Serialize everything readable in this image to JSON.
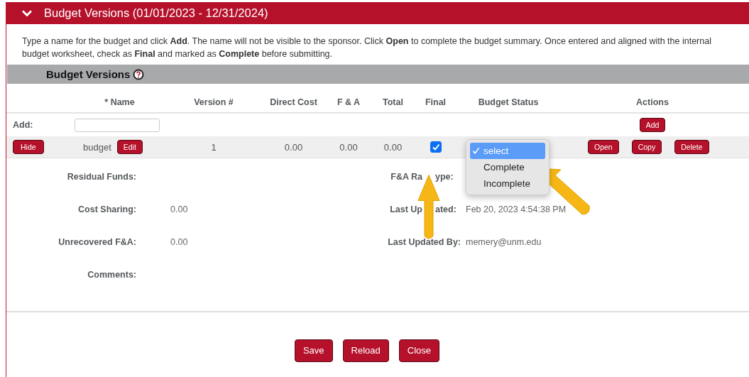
{
  "panel": {
    "title": "Budget Versions (01/01/2023 - 12/31/2024)",
    "expanded": true
  },
  "instructions": "Type a name for the budget and click **Add**. The name will not be visible to the sponsor. Click **Open** to complete the budget summary. Once entered and aligned with the internal budget worksheet, check as **Final** and marked as **Complete** before submitting.",
  "section": {
    "title": "Budget Versions"
  },
  "table": {
    "columns": [
      "* Name",
      "Version #",
      "Direct Cost",
      "F & A",
      "Total",
      "Final",
      "Budget Status",
      "Actions"
    ],
    "add_row": {
      "label": "Add:",
      "button": "Add"
    },
    "rows": [
      {
        "toggle_button": "Hide",
        "name": "budget",
        "edit_button": "Edit",
        "version": "1",
        "direct_cost": "0.00",
        "f_and_a": "0.00",
        "total": "0.00",
        "final": true,
        "actions": [
          "Open",
          "Copy",
          "Delete"
        ],
        "status_dropdown": {
          "options": [
            {
              "label": "select",
              "selected": true
            },
            {
              "label": "Complete",
              "selected": false
            },
            {
              "label": "Incomplete",
              "selected": false
            }
          ]
        }
      }
    ]
  },
  "details": [
    {
      "label": "Residual Funds:",
      "right_label": [
        "F&A Ra",
        "ype:"
      ]
    },
    {
      "label": "Cost Sharing:",
      "value": "0.00",
      "right_label": [
        "Last Up",
        "ated:"
      ],
      "right_value": "Feb 20, 2023 4:54:38 PM"
    },
    {
      "label": "Unrecovered F&A:",
      "value": "0.00",
      "right_label": [
        "Last Updated By:"
      ],
      "right_value": "memery@unm.edu"
    },
    {
      "label": "Comments:"
    }
  ],
  "buttons": [
    "Save",
    "Reload",
    "Close"
  ]
}
